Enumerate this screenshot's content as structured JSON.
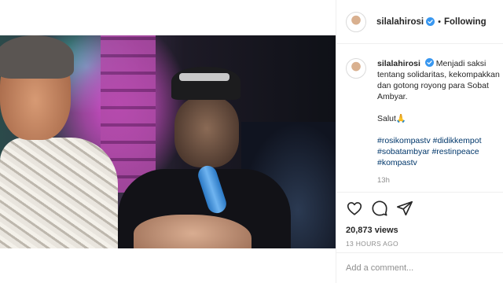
{
  "post": {
    "username": "silalahirosi",
    "follow_status": "Following",
    "separator": "•"
  },
  "caption": {
    "username": "silalahirosi",
    "text": "Menjadi saksi tentang solidaritas, kekompakkan dan gotong royong para Sobat Ambyar.",
    "salut": "Salut🙏",
    "hashtags": [
      "#rosikompastv",
      "#didikkempot",
      "#sobatambyar",
      "#restinpeace",
      "#kompastv"
    ],
    "time": "13h"
  },
  "actions": {
    "icons": [
      "heart-icon",
      "comment-icon",
      "share-icon"
    ],
    "views": "20,873 views",
    "posted": "13 HOURS AGO"
  },
  "comment_input": {
    "placeholder": "Add a comment..."
  },
  "colors": {
    "verified": "#3897f0",
    "hashtag": "#00376b",
    "secondary_text": "#8e8e8e"
  }
}
